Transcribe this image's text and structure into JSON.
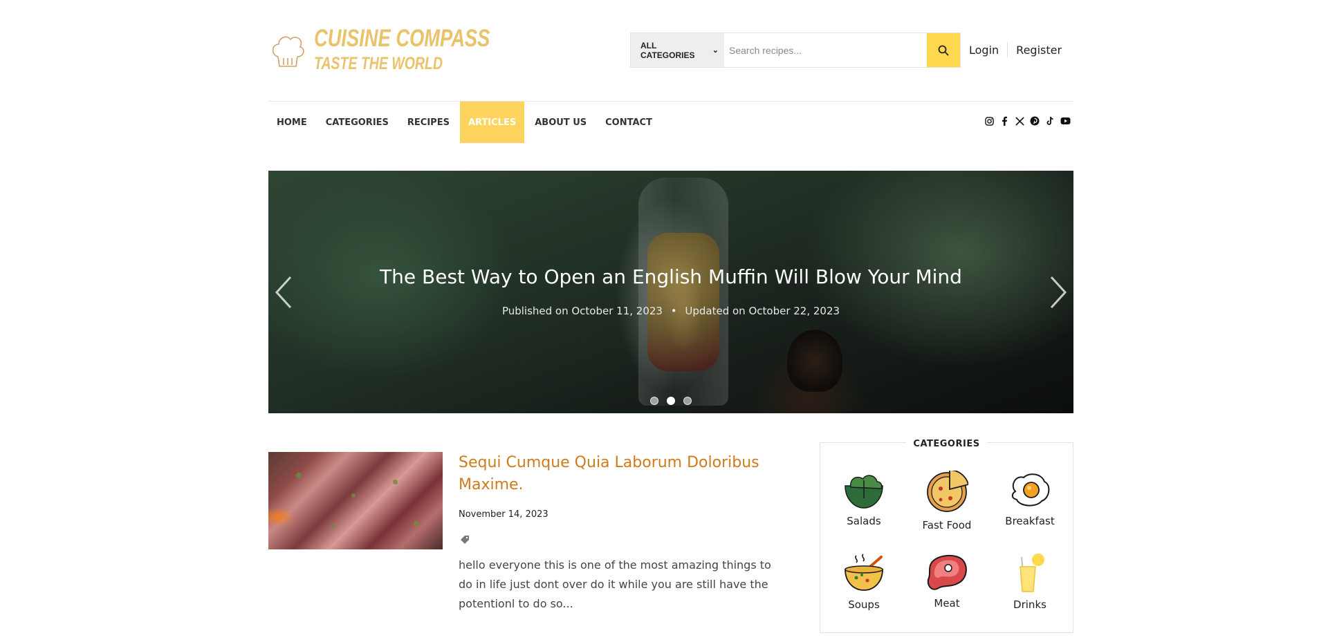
{
  "brand": {
    "title": "CUISINE COMPASS",
    "tagline": "TASTE THE WORLD",
    "accent": "#e8c36a"
  },
  "search": {
    "category_selected": "ALL CATEGORIES",
    "placeholder": "Search recipes...",
    "button_color": "#ffd84d"
  },
  "auth": {
    "login": "Login",
    "register": "Register"
  },
  "nav": {
    "items": [
      {
        "label": "HOME",
        "active": false
      },
      {
        "label": "CATEGORIES",
        "active": false
      },
      {
        "label": "RECIPES",
        "active": false
      },
      {
        "label": "ARTICLES",
        "active": true
      },
      {
        "label": "ABOUT US",
        "active": false
      },
      {
        "label": "CONTACT",
        "active": false
      }
    ],
    "active_color": "#ffd45e",
    "social": [
      "instagram-icon",
      "facebook-icon",
      "x-icon",
      "pinterest-icon",
      "tiktok-icon",
      "youtube-icon"
    ]
  },
  "hero": {
    "title": "The Best Way to Open an English Muffin Will Blow Your Mind",
    "published": "Published on October 11, 2023",
    "separator": "•",
    "updated": "Updated on October 22, 2023",
    "slides": 3,
    "current_slide": 2
  },
  "article": {
    "title": "Sequi Cumque Quia Laborum Doloribus Maxime.",
    "date": "November 14, 2023",
    "excerpt": "hello everyone this is one of the most amazing things to do in life just dont over do it while you are still have the potentionl to do so...",
    "title_color": "#d17a1c"
  },
  "categories": {
    "heading": "CATEGORIES",
    "items": [
      {
        "label": "Salads",
        "icon": "salad-icon"
      },
      {
        "label": "Fast Food",
        "icon": "pizza-icon"
      },
      {
        "label": "Breakfast",
        "icon": "fried-egg-icon"
      },
      {
        "label": "Soups",
        "icon": "soup-bowl-icon"
      },
      {
        "label": "Meat",
        "icon": "steak-icon"
      },
      {
        "label": "Drinks",
        "icon": "drink-glass-icon"
      }
    ]
  }
}
